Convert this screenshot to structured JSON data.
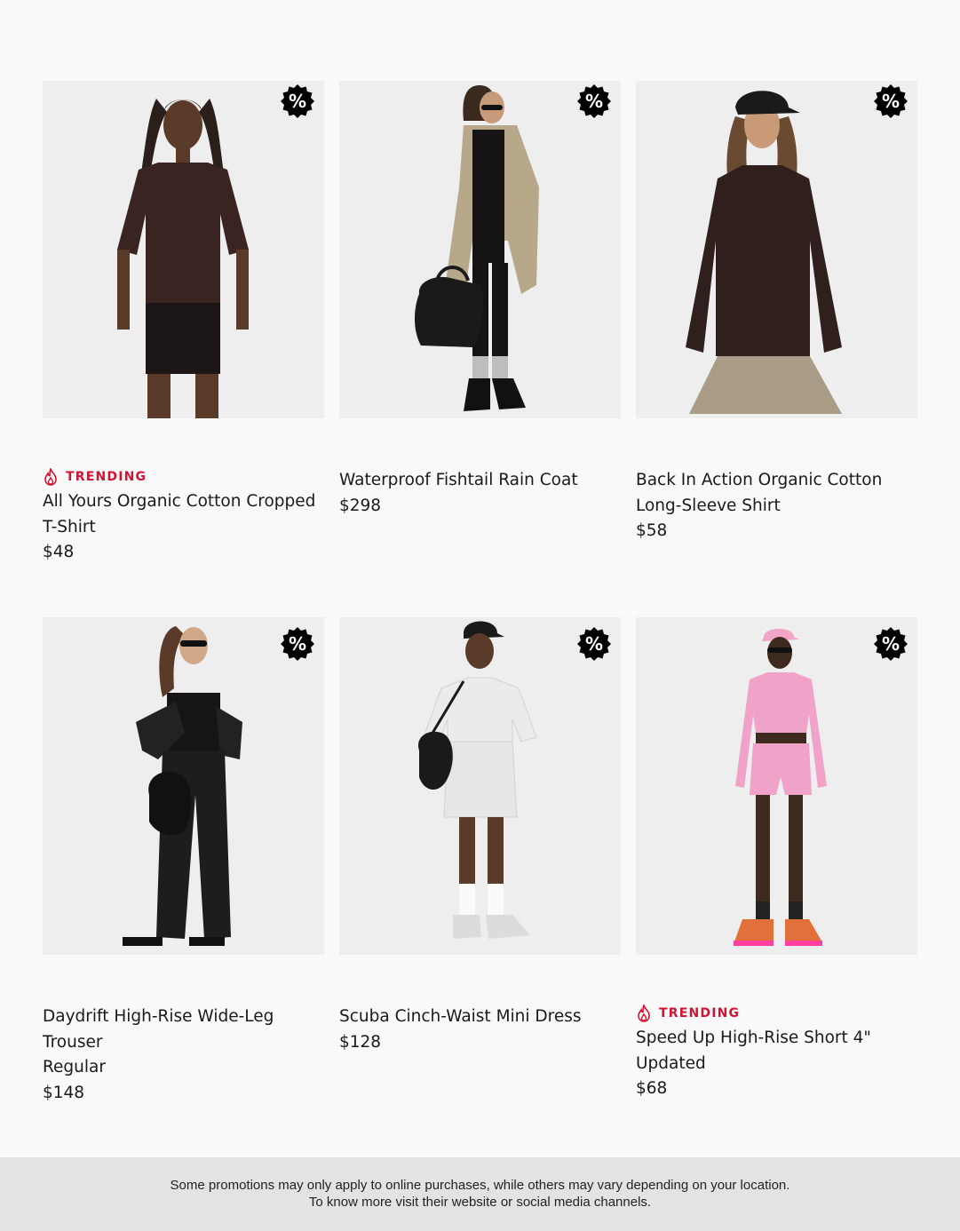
{
  "colors": {
    "background": "#f9f9f9",
    "photo_background": "#eeeeee",
    "trending_red": "#d31334",
    "badge_black": "#000000",
    "footer_background": "#e3e3e3"
  },
  "products": [
    {
      "badge": "%",
      "trending": true,
      "trending_label": "TRENDING",
      "name_lines": [
        "All Yours Organic Cotton Cropped",
        "T-Shirt"
      ],
      "price": "$48"
    },
    {
      "badge": "%",
      "trending": false,
      "trending_label": "",
      "name_lines": [
        "Waterproof Fishtail Rain Coat"
      ],
      "price": "$298"
    },
    {
      "badge": "%",
      "trending": false,
      "trending_label": "",
      "name_lines": [
        "Back In Action Organic Cotton",
        "Long-Sleeve Shirt"
      ],
      "price": "$58"
    },
    {
      "badge": "%",
      "trending": false,
      "trending_label": "",
      "name_lines": [
        "Daydrift High-Rise Wide-Leg",
        "Trouser",
        "Regular"
      ],
      "price": "$148"
    },
    {
      "badge": "%",
      "trending": false,
      "trending_label": "",
      "name_lines": [
        "Scuba Cinch-Waist Mini Dress"
      ],
      "price": "$128"
    },
    {
      "badge": "%",
      "trending": true,
      "trending_label": "TRENDING",
      "name_lines": [
        "Speed Up High-Rise Short 4\"",
        "Updated"
      ],
      "price": "$68"
    }
  ],
  "footer": {
    "line1": "Some promotions may only apply to online purchases, while others may vary depending on your location.",
    "line2": "To know more visit their website or social media channels."
  }
}
